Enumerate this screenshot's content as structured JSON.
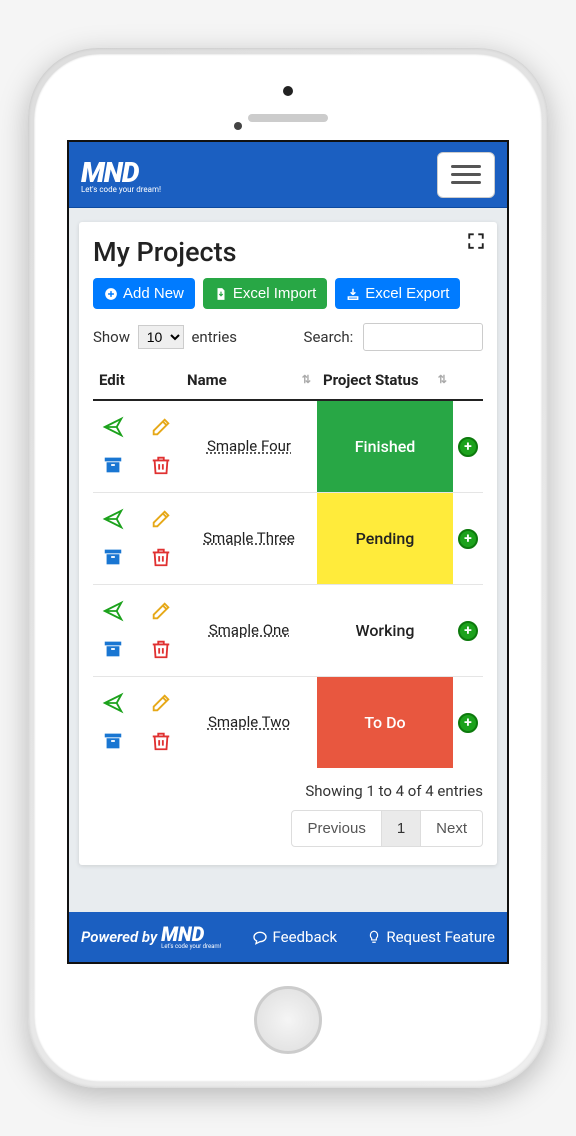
{
  "header": {
    "brand_main": "MND",
    "brand_sub": "Let's code your dream!"
  },
  "page": {
    "title": "My Projects",
    "buttons": {
      "add_new": "Add New",
      "excel_import": "Excel Import",
      "excel_export": "Excel Export"
    }
  },
  "table_controls": {
    "show_label": "Show",
    "entries_label": "entries",
    "entries_value": "10",
    "search_label": "Search:",
    "search_value": ""
  },
  "columns": {
    "edit": "Edit",
    "name": "Name",
    "status": "Project Status"
  },
  "rows": [
    {
      "name": "Smaple Four",
      "status": "Finished",
      "status_class": "st-finished"
    },
    {
      "name": "Smaple Three",
      "status": "Pending",
      "status_class": "st-pending"
    },
    {
      "name": "Smaple One",
      "status": "Working",
      "status_class": "st-working"
    },
    {
      "name": "Smaple Two",
      "status": "To Do",
      "status_class": "st-todo"
    }
  ],
  "info_text": "Showing 1 to 4 of 4 entries",
  "pager": {
    "prev": "Previous",
    "page": "1",
    "next": "Next"
  },
  "footer": {
    "powered_by": "Powered by",
    "feedback": "Feedback",
    "request": "Request Feature"
  }
}
